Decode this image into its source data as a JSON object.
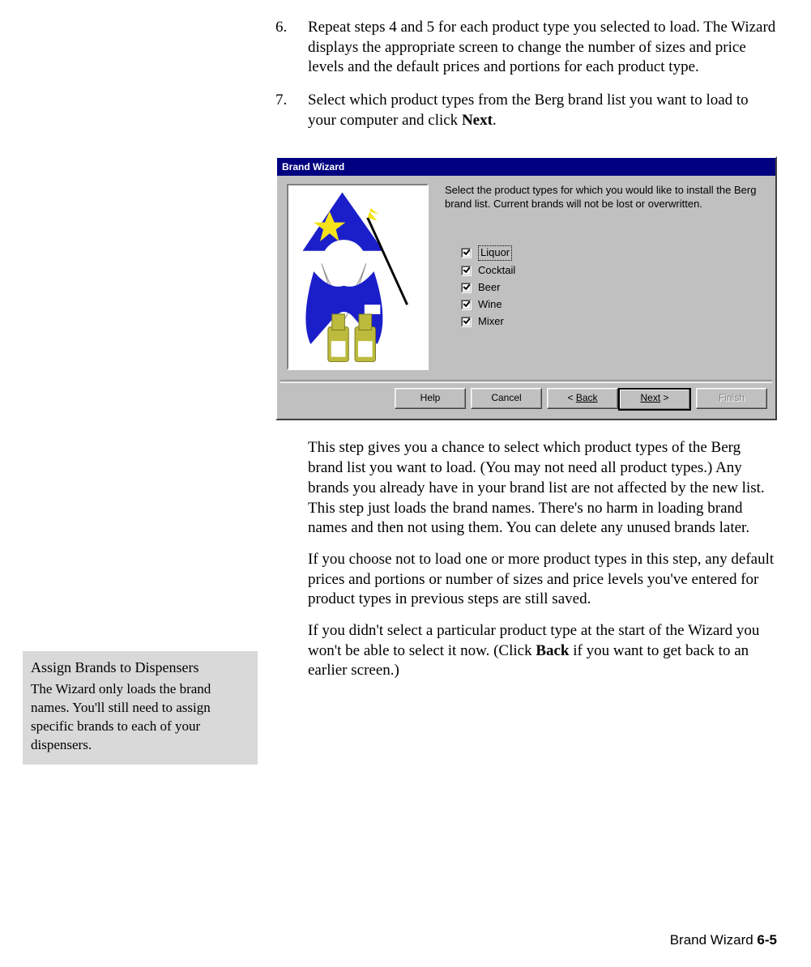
{
  "steps": {
    "s6num": "6.",
    "s6": "Repeat steps 4 and 5 for each product type you selected to load. The Wizard displays the appropriate screen to change the number of sizes and price levels and the default prices and portions for each product type.",
    "s7num": "7.",
    "s7a": "Select which product types from the Berg brand list you want to load to your computer and click ",
    "s7b": "Next",
    "s7c": "."
  },
  "dialog": {
    "title": "Brand Wizard",
    "instruction": "Select the product types for which you would like to install the Berg brand list. Current brands will not be lost or overwritten.",
    "options": [
      "Liquor",
      "Cocktail",
      "Beer",
      "Wine",
      "Mixer"
    ],
    "buttons": {
      "help": "Help",
      "cancel": "Cancel",
      "back": "Back",
      "next": "Next",
      "finish": "Finish"
    }
  },
  "body": {
    "p1": "This step gives you a chance to select which product types of the Berg brand list you want to load. (You may not need all product types.) Any brands you already have in your brand list are not affected by the new list. This step just loads the brand names. There's no harm in loading brand names and then not using them. You can delete any unused brands later.",
    "p2": "If you choose not to load one or more product types in this step, any default prices and portions or number of sizes and price levels you've entered for product types in previous steps are still saved.",
    "p3a": "If you didn't select a particular product type at the start of the Wizard you won't be able to select it now. (Click ",
    "p3b": "Back",
    "p3c": " if you want to get back to an earlier screen.)"
  },
  "callout": {
    "title": "Assign Brands to Dispensers",
    "body": "The Wizard only loads the brand names. You'll still need to assign specific brands to each of your dispensers."
  },
  "footer": {
    "label": "Brand Wizard ",
    "pagenum": "6-5"
  }
}
